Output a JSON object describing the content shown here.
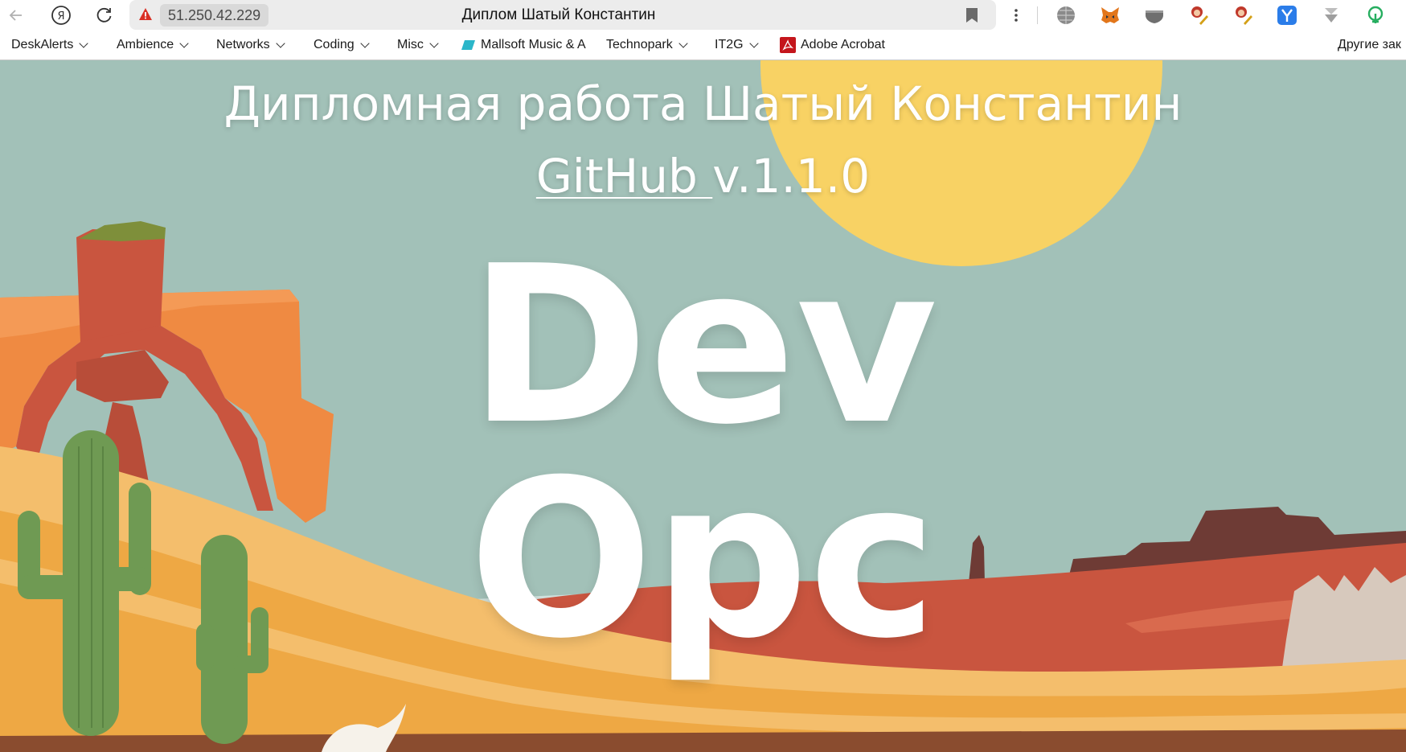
{
  "browser": {
    "url": "51.250.42.229",
    "tab_title": "Диплом Шатый Константин",
    "bookmarks": [
      {
        "label": "DeskAlerts",
        "has_menu": true
      },
      {
        "label": "Ambience",
        "has_menu": true
      },
      {
        "label": "Networks",
        "has_menu": true
      },
      {
        "label": "Coding",
        "has_menu": true
      },
      {
        "label": "Misc",
        "has_menu": true
      },
      {
        "label": "Mallsoft Music & A",
        "has_menu": false,
        "icon": "mallsoft-icon"
      },
      {
        "label": "Technopark",
        "has_menu": true
      },
      {
        "label": "IT2G",
        "has_menu": true
      },
      {
        "label": "Adobe Acrobat",
        "has_menu": false,
        "icon": "adobe-acrobat-icon"
      }
    ],
    "other_bookmarks": "Другие зак",
    "extensions": [
      "globe-icon",
      "metamask-fox-icon",
      "shield-extension-icon",
      "profile-extension-icon",
      "profile-extension-icon-2",
      "yandex-extension-icon",
      "download-extension-icon",
      "green-extension-icon"
    ]
  },
  "page": {
    "title": "Дипломная работа Шатый Константин",
    "github_link": "GitHub ",
    "version": "v.1.1.0",
    "hero_line1": "Dev",
    "hero_line2": "Opc"
  },
  "colors": {
    "sky": "#a2c1b8",
    "sun": "#f8d264",
    "rock_orange": "#ef8a42",
    "rock_red": "#c9553f",
    "sand_light": "#f4be6c",
    "sand": "#eea844",
    "cactus": "#6f9a53"
  }
}
